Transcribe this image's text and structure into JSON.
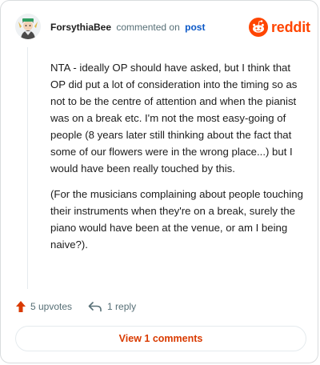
{
  "header": {
    "username": "ForsythiaBee",
    "action": "commented on",
    "link": "post",
    "brand": "reddit",
    "brand_color": "#ff4500"
  },
  "comment": {
    "paragraphs": [
      "NTA - ideally OP should have asked, but I think that OP did put a lot of consideration into the timing so as not to be the centre of attention and when the pianist was on a break etc. I'm not the most easy-going of people (8 years later still thinking about the fact that some of our flowers were in the wrong place...) but I would have been really touched by this.",
      "(For the musicians complaining about people touching their instruments when they're on a break, surely the piano would have been at the venue, or am I being naive?)."
    ]
  },
  "actions": {
    "upvotes": "5 upvotes",
    "upvote_icon": "arrow-up-icon",
    "upvote_color": "#d93a00",
    "replies": "1 reply",
    "reply_icon": "reply-arrow-icon"
  },
  "footer": {
    "view_comments": "View 1 comments",
    "accent": "#d93a00"
  }
}
